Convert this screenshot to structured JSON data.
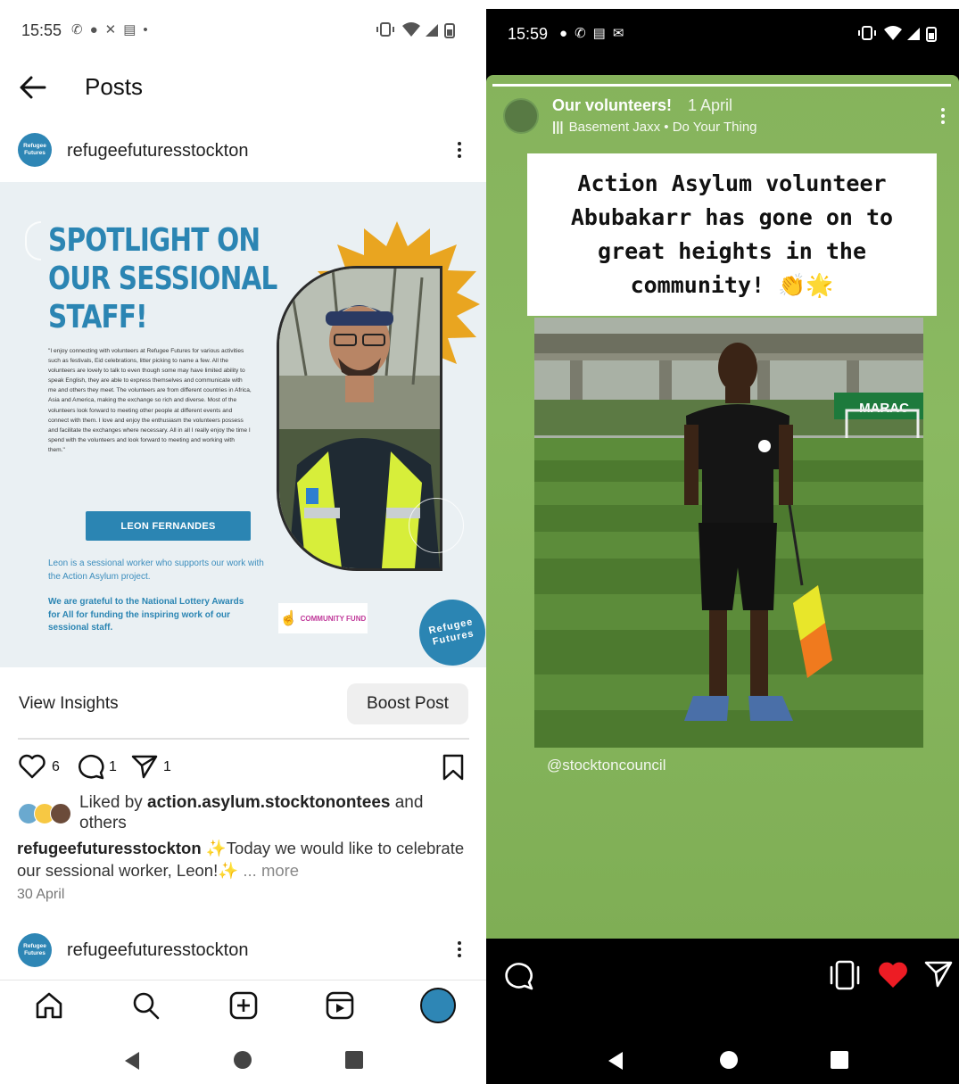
{
  "left": {
    "status": {
      "time": "15:55"
    },
    "header": {
      "title": "Posts"
    },
    "post": {
      "username": "refugeefuturesstockton",
      "avatar_text": "Refugee Futures",
      "image": {
        "headline": [
          "SPOTLIGHT ON",
          "OUR SESSIONAL",
          "STAFF!"
        ],
        "quote": "\"I enjoy connecting with volunteers at Refugee Futures for various activities such as festivals, Eid celebrations, litter picking to name a few. All the volunteers are lovely to talk to even though some may have limited ability to speak English, they are able to express themselves and communicate with me and others they meet. The volunteers are from different countries in Africa, Asia and America, making the exchange so rich and diverse. Most of the volunteers look forward to meeting other people at different events and connect with them. I love and enjoy the enthusiasm the volunteers possess and facilitate the exchanges where necessary. All in all I really enjoy the time I spend with the volunteers and look forward to meeting and working with them.\"",
        "name_button": "LEON FERNANDES",
        "caption1": "Leon is a sessional worker who supports our work with the Action Asylum project.",
        "caption2": "We are grateful to the National Lottery Awards for All for funding the inspiring work of our sessional staff.",
        "lottery_logo_text": "COMMUNITY FUND",
        "badge_text": "Refugee Futures"
      },
      "view_insights": "View Insights",
      "boost_post": "Boost Post",
      "likes_count": "6",
      "comments_count": "1",
      "shares_count": "1",
      "liked_by_prefix": "Liked by ",
      "liked_by_user": "action.asylum.stocktonontees",
      "liked_by_suffix": " and others",
      "caption_user": "refugeefuturesstockton",
      "caption_text": " ✨Today we would like to celebrate our sessional worker, Leon!✨",
      "caption_more": "... more",
      "date": "30 April",
      "next_username": "refugeefuturesstockton"
    }
  },
  "right": {
    "status": {
      "time": "15:59"
    },
    "story": {
      "name": "Our volunteers!",
      "date": "1 April",
      "music": "Basement Jaxx • Do Your Thing",
      "text": "Action Asylum volunteer Abubakarr has gone on to great heights in the community! 👏🌟",
      "banner_text": "MARAC",
      "mention": "@stocktoncouncil",
      "progress": 1.0
    }
  },
  "colors": {
    "brand_blue": "#2b85b3",
    "sun_orange": "#e9a520",
    "story_green": "#86b35c",
    "heart_red": "#ed1c24"
  }
}
